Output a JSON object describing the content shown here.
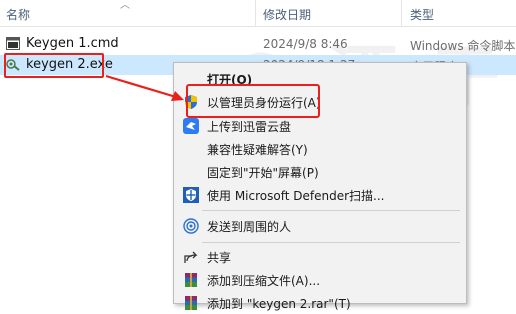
{
  "columns": {
    "name": "名称",
    "date": "修改日期",
    "type": "类型"
  },
  "files": [
    {
      "name": "Keygen 1.cmd",
      "date": "2024/9/8 8:46",
      "type": "Windows 命令脚本",
      "icon": "cmd-file-icon"
    },
    {
      "name": "keygen 2.exe",
      "date": "2024/9/18 1:27",
      "type": "应用程序",
      "icon": "exe-file-icon"
    }
  ],
  "watermark": "@ 酒 于 风",
  "context_menu": {
    "open": "打开(O)",
    "run_as_admin": "以管理员身份运行(A)",
    "upload_xunlei": "上传到迅雷云盘",
    "compat": "兼容性疑难解答(Y)",
    "pin_start": "固定到\"开始\"屏幕(P)",
    "defender": "使用 Microsoft Defender扫描...",
    "send_nearby": "发送到周围的人",
    "share": "共享",
    "add_archive": "添加到压缩文件(A)...",
    "add_archive_rar": "添加到 \"keygen 2.rar\"(T)"
  },
  "colors": {
    "highlight": "#e8211c",
    "selection": "#cce8ff",
    "arrow": "#e8211c"
  }
}
